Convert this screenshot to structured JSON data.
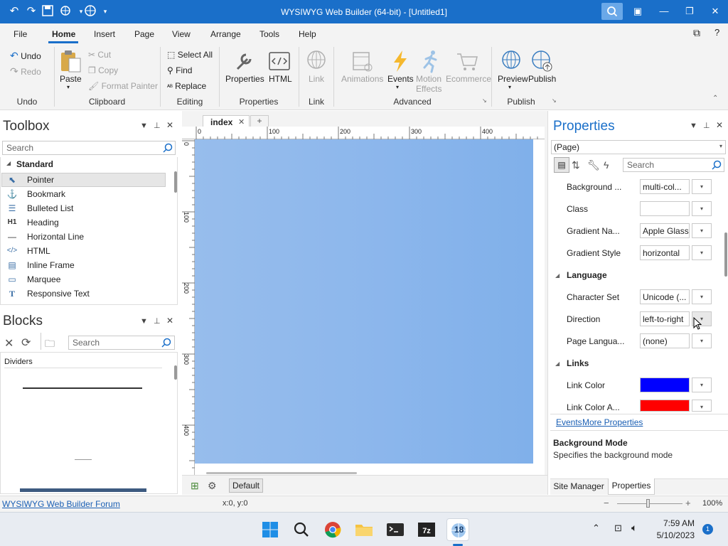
{
  "window": {
    "title": "WYSIWYG Web Builder (64-bit) - [Untitled1]"
  },
  "menu": {
    "file": "File",
    "home": "Home",
    "insert": "Insert",
    "page": "Page",
    "view": "View",
    "arrange": "Arrange",
    "tools": "Tools",
    "help": "Help"
  },
  "ribbon": {
    "undo": "Undo",
    "redo": "Redo",
    "undo_group": "Undo",
    "paste": "Paste",
    "cut": "Cut",
    "copy": "Copy",
    "format_painter": "Format Painter",
    "clipboard_group": "Clipboard",
    "select_all": "Select All",
    "find": "Find",
    "replace": "Replace",
    "editing_group": "Editing",
    "properties": "Properties",
    "html": "HTML",
    "properties_group": "Properties",
    "link": "Link",
    "link_group": "Link",
    "animations": "Animations",
    "events": "Events",
    "motion": "Motion",
    "effects": "Effects",
    "ecommerce": "Ecommerce",
    "advanced_group": "Advanced",
    "preview": "Preview",
    "publish": "Publish",
    "publish_group": "Publish"
  },
  "toolbox": {
    "title": "Toolbox",
    "search_placeholder": "Search",
    "category": "Standard",
    "items": [
      {
        "label": "Pointer",
        "icon": "pointer-icon"
      },
      {
        "label": "Bookmark",
        "icon": "anchor-icon"
      },
      {
        "label": "Bulleted List",
        "icon": "list-icon"
      },
      {
        "label": "Heading",
        "icon": "heading-icon"
      },
      {
        "label": "Horizontal Line",
        "icon": "hline-icon"
      },
      {
        "label": "HTML",
        "icon": "code-icon"
      },
      {
        "label": "Inline Frame",
        "icon": "frame-icon"
      },
      {
        "label": "Marquee",
        "icon": "marquee-icon"
      },
      {
        "label": "Responsive Text",
        "icon": "text-icon"
      }
    ]
  },
  "blocks": {
    "title": "Blocks",
    "search_placeholder": "Search",
    "category": "Dividers"
  },
  "editor": {
    "tab": "index",
    "ruler_h": [
      "0",
      "100",
      "200",
      "300",
      "400"
    ],
    "ruler_v": [
      "0",
      "100",
      "200",
      "300",
      "400"
    ],
    "canvas_bg": "#8db7ec",
    "default_label": "Default"
  },
  "properties": {
    "title": "Properties",
    "object": "(Page)",
    "search_placeholder": "Search",
    "rows": [
      {
        "label": "Background ...",
        "value": "multi-col..."
      },
      {
        "label": "Class",
        "value": ""
      },
      {
        "label": "Gradient Na...",
        "value": "Apple Glass"
      },
      {
        "label": "Gradient Style",
        "value": "horizontal"
      }
    ],
    "cat_language": "Language",
    "lang_rows": [
      {
        "label": "Character Set",
        "value": "Unicode (..."
      },
      {
        "label": "Direction",
        "value": "left-to-right"
      },
      {
        "label": "Page Langua...",
        "value": "(none)"
      }
    ],
    "cat_links": "Links",
    "link_rows": [
      {
        "label": "Link Color",
        "color": "#0000ff"
      },
      {
        "label": "Link Color A...",
        "color": "#ff0000"
      }
    ],
    "events_link": "Events",
    "more_link": "More Properties",
    "desc_title": "Background Mode",
    "desc_text": "Specifies the background mode",
    "tab_site": "Site Manager",
    "tab_props": "Properties"
  },
  "status": {
    "forum": "WYSIWYG Web Builder Forum",
    "coords": "x:0, y:0",
    "zoom": "100%"
  },
  "taskbar": {
    "time": "7:59 AM",
    "date": "5/10/2023",
    "badge": "1",
    "app_badge": "18"
  }
}
